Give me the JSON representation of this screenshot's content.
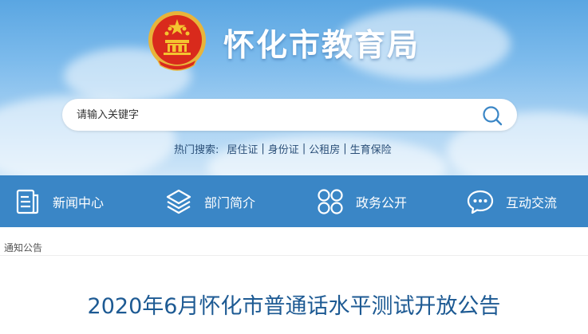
{
  "header": {
    "site_title": "怀化市教育局"
  },
  "search": {
    "placeholder": "请输入关键字"
  },
  "hot_search": {
    "label": "热门搜索:",
    "items": [
      "居住证",
      "身份证",
      "公租房",
      "生育保险"
    ]
  },
  "nav": {
    "items": [
      {
        "label": "新闻中心",
        "icon": "news-document-icon"
      },
      {
        "label": "部门简介",
        "icon": "layers-icon"
      },
      {
        "label": "政务公开",
        "icon": "grid-circles-icon"
      },
      {
        "label": "互动交流",
        "icon": "chat-bubble-icon"
      }
    ]
  },
  "breadcrumb": {
    "current": "通知公告"
  },
  "article": {
    "title": "2020年6月怀化市普通话水平测试开放公告"
  },
  "colors": {
    "nav_bg": "#3a86c6",
    "title_color": "#1d5a93",
    "sky_top": "#5aa6e2"
  }
}
